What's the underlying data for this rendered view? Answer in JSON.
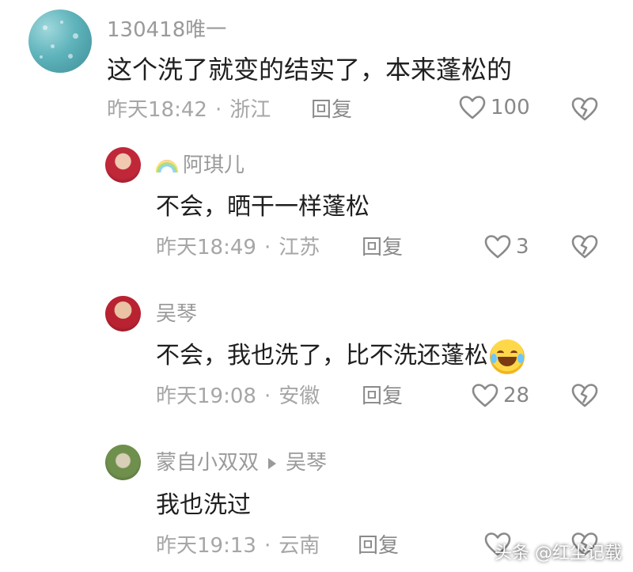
{
  "comments": [
    {
      "username": "130418唯一",
      "text": "这个洗了就变的结实了，本来蓬松的",
      "time": "昨天18:42",
      "location": "浙江",
      "reply_label": "回复",
      "likes": "100",
      "avatar_icon": "water-drops-avatar"
    },
    {
      "username": "阿琪儿",
      "text": "不会，晒干一样蓬松",
      "time": "昨天18:49",
      "location": "江苏",
      "reply_label": "回复",
      "likes": "3",
      "avatar_icon": "woman-red-dress-avatar",
      "username_prefix_icon": "rainbow-icon"
    },
    {
      "username": "吴琴",
      "text": "不会，我也洗了，比不洗还蓬松",
      "time": "昨天19:08",
      "location": "安徽",
      "reply_label": "回复",
      "likes": "28",
      "avatar_icon": "child-red-avatar",
      "text_suffix_icon": "laughing-crying-emoji"
    },
    {
      "username": "蒙自小双双",
      "reply_to": "吴琴",
      "text": "我也洗过",
      "time": "昨天19:13",
      "location": "云南",
      "reply_label": "回复",
      "avatar_icon": "flower-avatar"
    }
  ],
  "separator": "·",
  "watermark": "头条 @红尘记载"
}
